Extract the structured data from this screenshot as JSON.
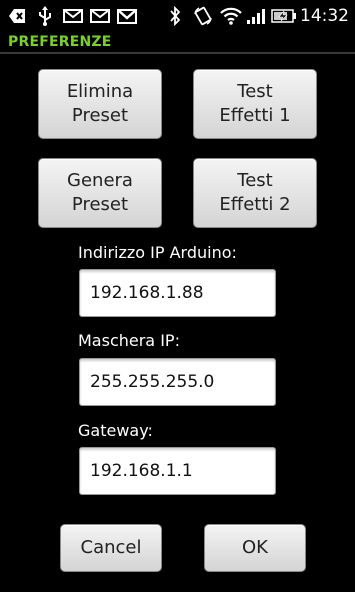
{
  "status_bar": {
    "time": "14:32",
    "icons": [
      "usb-debug-icon",
      "usb-icon",
      "mail-icon",
      "mail-icon",
      "gmail-icon",
      "bluetooth-icon",
      "rotation-lock-icon",
      "wifi-icon",
      "signal-icon",
      "battery-charging-icon"
    ]
  },
  "dialog": {
    "title": "PREFERENZE",
    "title_color": "#7ad12b"
  },
  "buttons": {
    "delete_preset": "Elimina\nPreset",
    "test_effects_1": "Test\nEffetti 1",
    "generate_preset": "Genera\nPreset",
    "test_effects_2": "Test\nEffetti 2",
    "cancel": "Cancel",
    "ok": "OK"
  },
  "fields": {
    "ip_label": "Indirizzo IP Arduino:",
    "ip_value": "192.168.1.88",
    "mask_label": "Maschera IP:",
    "mask_value": "255.255.255.0",
    "gateway_label": "Gateway:",
    "gateway_value": "192.168.1.1"
  }
}
